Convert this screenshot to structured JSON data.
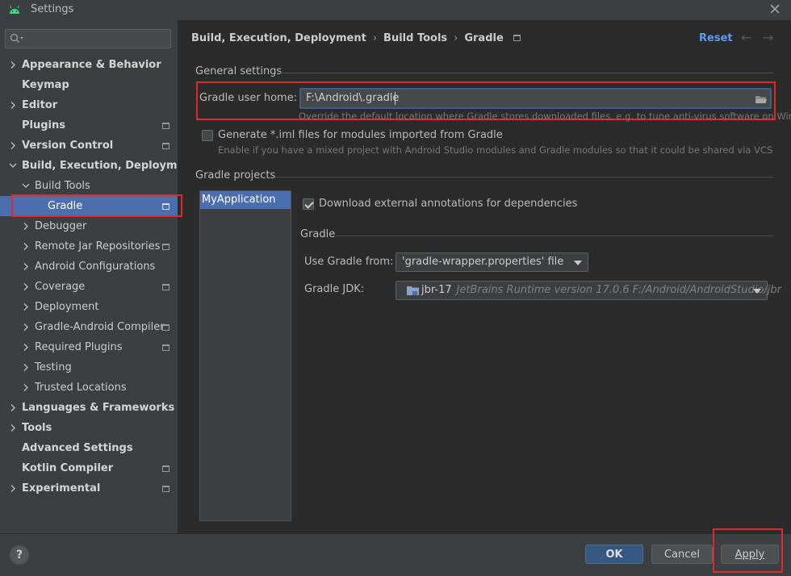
{
  "window": {
    "title": "Settings"
  },
  "sidebar": {
    "search_placeholder": "",
    "items": [
      {
        "label": "Appearance & Behavior",
        "has_chevron": true,
        "expanded": false,
        "bold": true
      },
      {
        "label": "Keymap",
        "has_chevron": false,
        "bold": true
      },
      {
        "label": "Editor",
        "has_chevron": true,
        "expanded": false,
        "bold": true
      },
      {
        "label": "Plugins",
        "has_chevron": false,
        "bold": true,
        "project_icon": true
      },
      {
        "label": "Version Control",
        "has_chevron": true,
        "expanded": false,
        "bold": true,
        "project_icon": true
      },
      {
        "label": "Build, Execution, Deployment",
        "has_chevron": true,
        "expanded": true,
        "bold": true
      },
      {
        "label": "Build Tools",
        "has_chevron": true,
        "expanded": true
      },
      {
        "label": "Gradle",
        "selected": true,
        "project_icon": true
      },
      {
        "label": "Debugger",
        "has_chevron": true
      },
      {
        "label": "Remote Jar Repositories",
        "has_chevron": true,
        "project_icon": true
      },
      {
        "label": "Android Configurations",
        "has_chevron": true
      },
      {
        "label": "Coverage",
        "has_chevron": true,
        "project_icon": true
      },
      {
        "label": "Deployment",
        "has_chevron": true
      },
      {
        "label": "Gradle-Android Compiler",
        "has_chevron": true,
        "project_icon": true
      },
      {
        "label": "Required Plugins",
        "has_chevron": true,
        "project_icon": true
      },
      {
        "label": "Testing",
        "has_chevron": true
      },
      {
        "label": "Trusted Locations",
        "has_chevron": true
      },
      {
        "label": "Languages & Frameworks",
        "has_chevron": true,
        "bold": true
      },
      {
        "label": "Tools",
        "has_chevron": true,
        "bold": true
      },
      {
        "label": "Advanced Settings",
        "has_chevron": false,
        "bold": true
      },
      {
        "label": "Kotlin Compiler",
        "has_chevron": false,
        "bold": true,
        "project_icon": true
      },
      {
        "label": "Experimental",
        "has_chevron": true,
        "bold": true,
        "project_icon": true
      }
    ]
  },
  "breadcrumb": {
    "items": [
      "Build, Execution, Deployment",
      "Build Tools",
      "Gradle"
    ]
  },
  "header": {
    "reset_label": "Reset",
    "back_arrow": "←",
    "forward_arrow": "→"
  },
  "general": {
    "section_title": "General settings",
    "user_home_label": "Gradle user home:",
    "user_home_value": "F:\\Android\\.gradle",
    "user_home_hint": "Override the default location where Gradle stores downloaded files, e.g. to tune anti-virus software on Windows",
    "generate_iml_label": "Generate *.iml files for modules imported from Gradle",
    "generate_iml_checked": false,
    "generate_iml_hint": "Enable if you have a mixed project with Android Studio modules and Gradle modules so that it could be shared via VCS"
  },
  "projects": {
    "section_title": "Gradle projects",
    "list": [
      "MyApplication"
    ],
    "download_annotations_label": "Download external annotations for dependencies",
    "download_annotations_checked": true,
    "gradle_section_title": "Gradle",
    "use_gradle_from_label": "Use Gradle from:",
    "use_gradle_from_value": "'gradle-wrapper.properties' file",
    "gradle_jdk_label": "Gradle JDK:",
    "gradle_jdk_name": "jbr-17",
    "gradle_jdk_desc": "JetBrains Runtime version 17.0.6 F:/Android/AndroidStudio/jbr"
  },
  "footer": {
    "help_label": "?",
    "ok_label": "OK",
    "cancel_label": "Cancel",
    "apply_label": "Apply"
  },
  "colors": {
    "accent": "#4b6eaf",
    "link": "#589df6",
    "highlight_box": "#e0282f"
  }
}
